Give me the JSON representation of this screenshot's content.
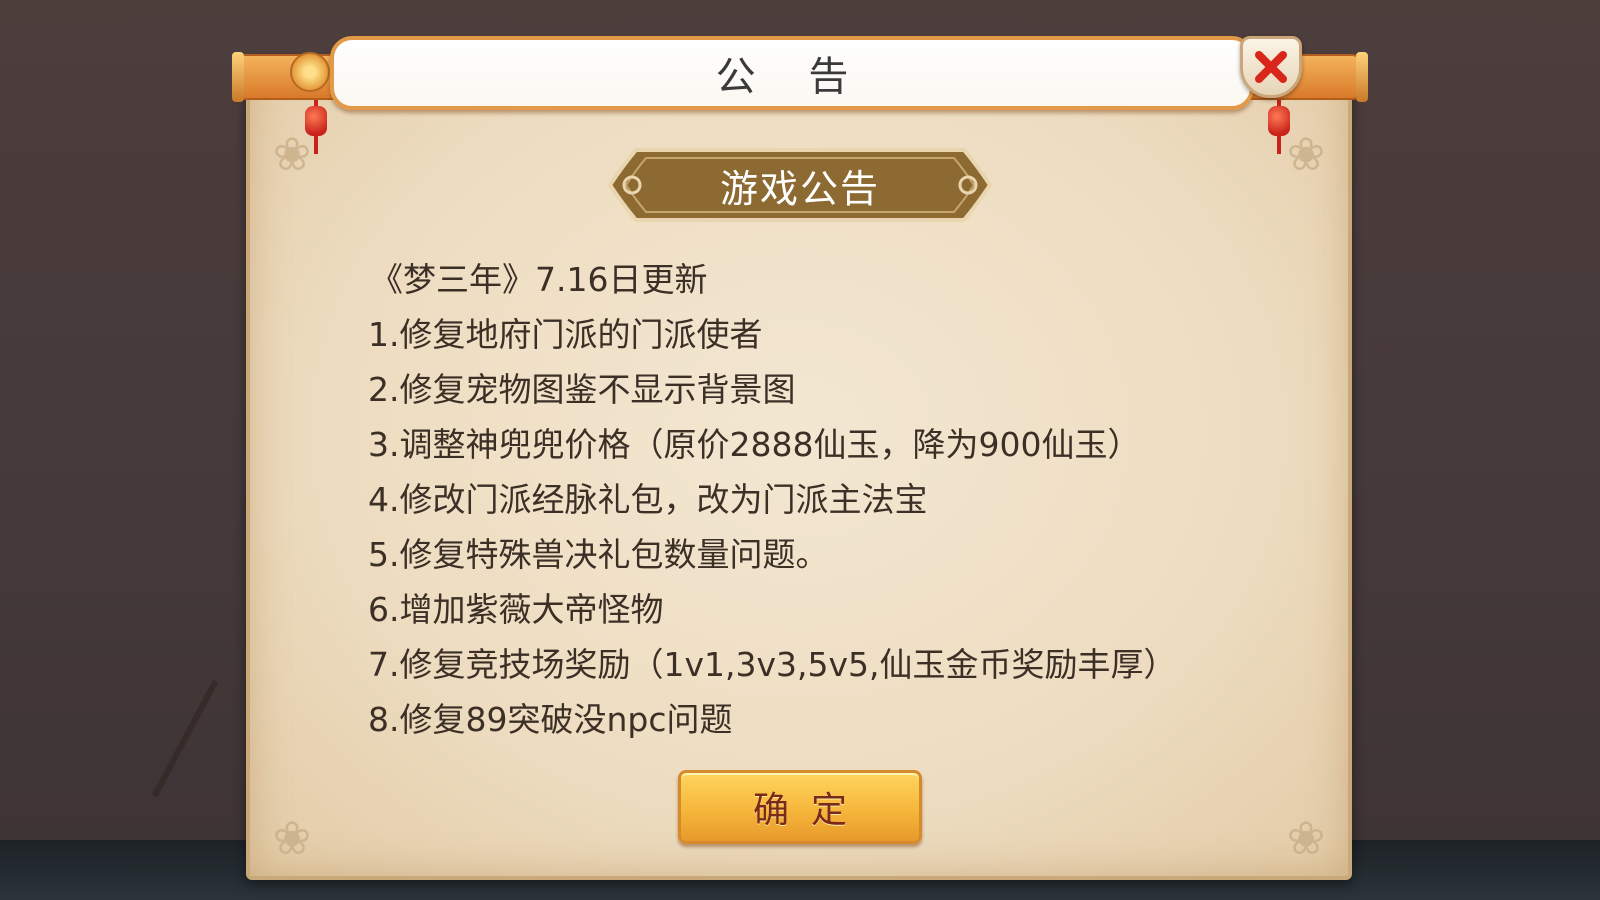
{
  "dialog": {
    "title": "公 告",
    "heading": "游戏公告",
    "close_icon": "close-x-icon",
    "lines": [
      "《梦三年》7.16日更新",
      "1.修复地府门派的门派使者",
      "2.修复宠物图鉴不显示背景图",
      "3.调整神兜兜价格（原价2888仙玉，降为900仙玉）",
      "4.修改门派经脉礼包，改为门派主法宝",
      "5.修复特殊兽决礼包数量问题。",
      "6.增加紫薇大帝怪物",
      "7.修复竞技场奖励（1v1,3v3,5v5,仙玉金币奖励丰厚）",
      "8.修复89突破没npc问题"
    ],
    "confirm_label": "确定"
  },
  "colors": {
    "panel": "#f3e7d2",
    "title_border": "#e39a48",
    "plaque": "#8c6a32",
    "close_x": "#d8261a",
    "button": "#f6b63c"
  }
}
